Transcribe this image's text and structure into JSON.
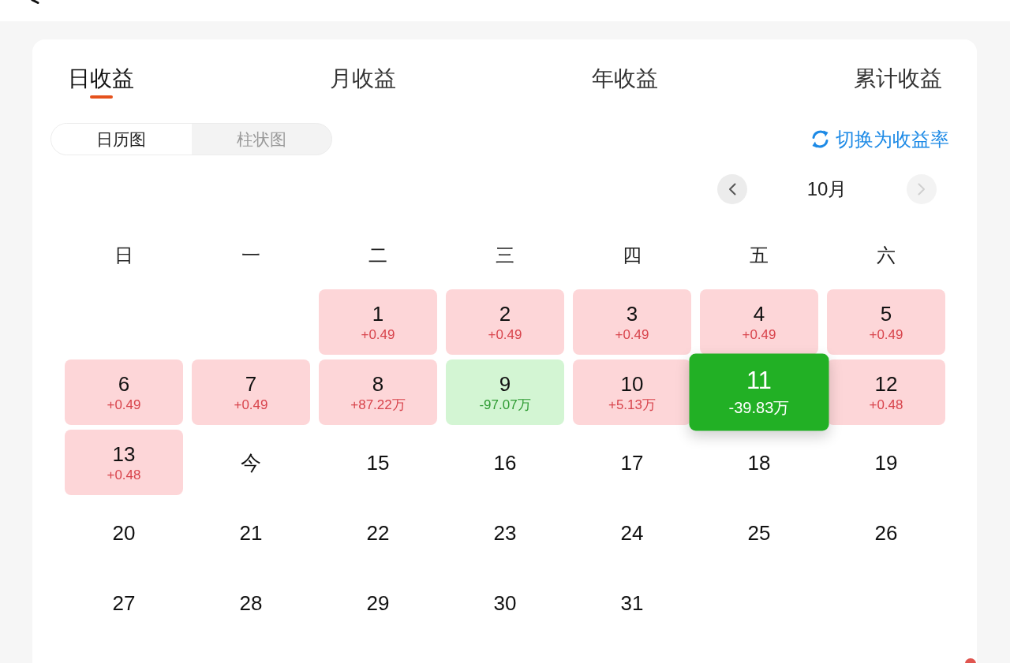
{
  "tabs": [
    {
      "label": "日收益",
      "selected": true
    },
    {
      "label": "月收益",
      "selected": false
    },
    {
      "label": "年收益",
      "selected": false
    },
    {
      "label": "累计收益",
      "selected": false
    }
  ],
  "view_switch": [
    {
      "label": "日历图",
      "selected": true
    },
    {
      "label": "柱状图",
      "selected": false
    }
  ],
  "rate_toggle": {
    "label": "切换为收益率"
  },
  "month_nav": {
    "prev_disabled": false,
    "label": "10月",
    "next_disabled": true
  },
  "calendar": {
    "weekdays": [
      "日",
      "一",
      "二",
      "三",
      "四",
      "五",
      "六"
    ],
    "weeks": [
      {
        "kind": "partial_start",
        "days": [
          {
            "label": "1",
            "value": "+0.49",
            "kind": "gain",
            "selected": false
          },
          {
            "label": "2",
            "value": "+0.49",
            "kind": "gain",
            "selected": false
          },
          {
            "label": "3",
            "value": "+0.49",
            "kind": "gain",
            "selected": false
          },
          {
            "label": "4",
            "value": "+0.49",
            "kind": "gain",
            "selected": false
          },
          {
            "label": "5",
            "value": "+0.49",
            "kind": "gain",
            "selected": false
          }
        ]
      },
      {
        "kind": "full",
        "days": [
          {
            "label": "6",
            "value": "+0.49",
            "kind": "gain",
            "selected": false
          },
          {
            "label": "7",
            "value": "+0.49",
            "kind": "gain",
            "selected": false
          },
          {
            "label": "8",
            "value": "+87.22万",
            "kind": "gain",
            "selected": false
          },
          {
            "label": "9",
            "value": "-97.07万",
            "kind": "loss",
            "selected": false
          },
          {
            "label": "10",
            "value": "+5.13万",
            "kind": "gain",
            "selected": false
          },
          {
            "label": "11",
            "value": "-39.83万",
            "kind": "loss",
            "selected": true
          },
          {
            "label": "12",
            "value": "+0.48",
            "kind": "gain",
            "selected": false
          }
        ]
      },
      {
        "kind": "full",
        "days": [
          {
            "label": "13",
            "value": "+0.48",
            "kind": "gain",
            "selected": false
          },
          {
            "label": "今",
            "kind": "plain",
            "selected": false
          },
          {
            "label": "15",
            "kind": "plain",
            "selected": false
          },
          {
            "label": "16",
            "kind": "plain",
            "selected": false
          },
          {
            "label": "17",
            "kind": "plain",
            "selected": false
          },
          {
            "label": "18",
            "kind": "plain",
            "selected": false
          },
          {
            "label": "19",
            "kind": "plain",
            "selected": false
          }
        ]
      },
      {
        "kind": "full",
        "days": [
          {
            "label": "20",
            "kind": "plain",
            "selected": false
          },
          {
            "label": "21",
            "kind": "plain",
            "selected": false
          },
          {
            "label": "22",
            "kind": "plain",
            "selected": false
          },
          {
            "label": "23",
            "kind": "plain",
            "selected": false
          },
          {
            "label": "24",
            "kind": "plain",
            "selected": false
          },
          {
            "label": "25",
            "kind": "plain",
            "selected": false
          },
          {
            "label": "26",
            "kind": "plain",
            "selected": false
          }
        ]
      },
      {
        "kind": "partial_end",
        "days": [
          {
            "label": "27",
            "kind": "plain",
            "selected": false
          },
          {
            "label": "28",
            "kind": "plain",
            "selected": false
          },
          {
            "label": "29",
            "kind": "plain",
            "selected": false
          },
          {
            "label": "30",
            "kind": "plain",
            "selected": false
          },
          {
            "label": "31",
            "kind": "plain",
            "selected": false
          }
        ]
      }
    ]
  }
}
